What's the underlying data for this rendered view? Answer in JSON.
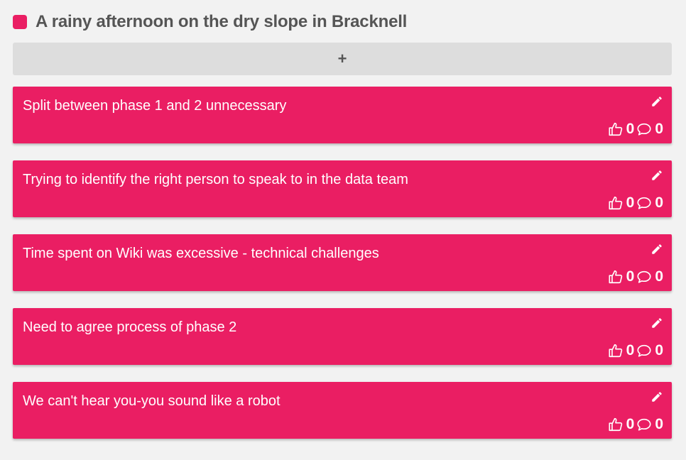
{
  "colors": {
    "accent": "#ea1e63",
    "background": "#f2f2f2",
    "add_bar": "#dddddd",
    "title_text": "#555555"
  },
  "column": {
    "title": "A rainy afternoon on the dry slope in Bracknell",
    "add_label": "+"
  },
  "cards": [
    {
      "text": "Split between phase 1 and 2 unnecessary",
      "likes": "0",
      "comments": "0"
    },
    {
      "text": "Trying to identify the right person to speak to in the data team",
      "likes": "0",
      "comments": "0"
    },
    {
      "text": "Time spent on Wiki was excessive - technical challenges",
      "likes": "0",
      "comments": "0"
    },
    {
      "text": "Need to agree process of phase 2",
      "likes": "0",
      "comments": "0"
    },
    {
      "text": "We can't hear you-you sound like a robot",
      "likes": "0",
      "comments": "0"
    }
  ],
  "icons": {
    "edit": "pencil-icon",
    "like": "thumbs-up-icon",
    "comment": "comment-icon"
  }
}
